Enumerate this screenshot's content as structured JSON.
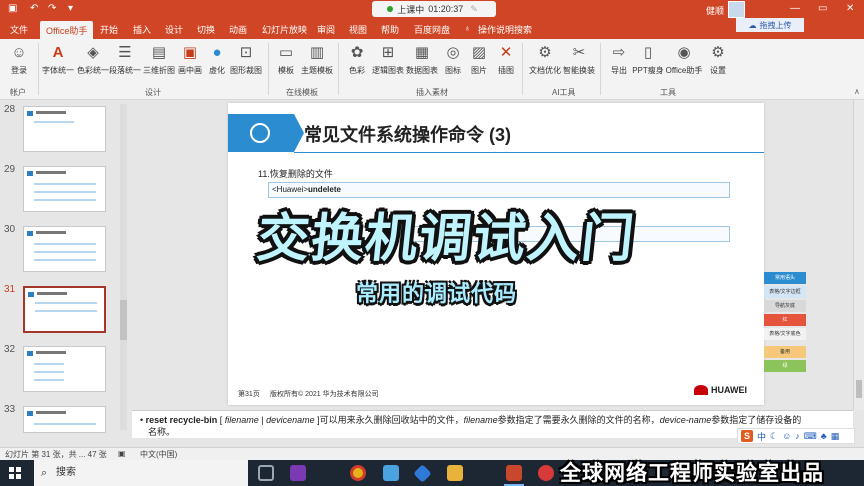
{
  "titlebar": {
    "save_icon": "save-icon",
    "undo_icon": "undo-icon",
    "redo_icon": "redo-icon",
    "recording_label": "上课中",
    "recording_time": "01:20:37",
    "user_name": "健顺",
    "minimize": "—",
    "maximize": "▭",
    "close": "✕"
  },
  "tabs": [
    "文件",
    "Office助手",
    "开始",
    "插入",
    "设计",
    "切换",
    "动画",
    "幻灯片放映",
    "审阅",
    "视图",
    "帮助",
    "百度网盘"
  ],
  "active_tab": "Office助手",
  "tell_me": "操作说明搜索",
  "upload_label": "拖拽上传",
  "ribbon": {
    "buttons": [
      {
        "label": "登录",
        "icon": "login-icon"
      },
      {
        "label": "字体统一",
        "icon": "font-icon"
      },
      {
        "label": "色彩统一",
        "icon": "paint-bucket-icon"
      },
      {
        "label": "段落统一",
        "icon": "paragraph-icon"
      },
      {
        "label": "三维折图",
        "icon": "fold-icon"
      },
      {
        "label": "画中画",
        "icon": "picture-in-picture-icon"
      },
      {
        "label": "虚化",
        "icon": "blur-icon"
      },
      {
        "label": "图形裁图",
        "icon": "crop-icon"
      },
      {
        "label": "模板",
        "icon": "template-icon"
      },
      {
        "label": "主题模板",
        "icon": "theme-icon"
      },
      {
        "label": "色彩",
        "icon": "palette-icon"
      },
      {
        "label": "逻辑图表",
        "icon": "logic-chart-icon"
      },
      {
        "label": "数据图表",
        "icon": "data-chart-icon"
      },
      {
        "label": "图标",
        "icon": "icon-library-icon"
      },
      {
        "label": "图片",
        "icon": "image-icon"
      },
      {
        "label": "插图",
        "icon": "illustration-icon"
      },
      {
        "label": "文档优化",
        "icon": "optimize-icon"
      },
      {
        "label": "智能换装",
        "icon": "smart-dress-icon"
      },
      {
        "label": "导出",
        "icon": "export-icon"
      },
      {
        "label": "PPT瘦身",
        "icon": "slim-icon"
      },
      {
        "label": "Office助手",
        "icon": "assistant-icon"
      },
      {
        "label": "设置",
        "icon": "settings-icon"
      }
    ],
    "groups": [
      "帐户",
      "设计",
      "在线模板",
      "插入素材",
      "AI工具",
      "工具"
    ]
  },
  "thumbnails": {
    "numbers": [
      "28",
      "29",
      "30",
      "31",
      "32",
      "33"
    ],
    "selected": "31"
  },
  "slide": {
    "title": "常见文件系统操作命令 (3)",
    "item": "11.恢复删除的文件",
    "cmd_prefix": "<Huawei>",
    "cmd_bold": "undelete",
    "footer_page": "第31页",
    "footer_copy": "版权所有© 2021 华为技术有限公司",
    "logo": "HUAWEI"
  },
  "overlay": {
    "title": "交换机调试入门",
    "subtitle": "常用的调试代码"
  },
  "palette": [
    {
      "label": "常用语头",
      "color": "#2b8dd0"
    },
    {
      "label": "表格/文字边框",
      "color": "#d4e5f5"
    },
    {
      "label": "导航灰底",
      "color": "#d9d9d9"
    },
    {
      "label": "红",
      "color": "#e5543c"
    },
    {
      "label": "表格/文字底色",
      "color": "#f2f2f2"
    },
    {
      "label": "备用",
      "color": "#f7c87a"
    },
    {
      "label": "绿",
      "color": "#8cc35a"
    }
  ],
  "notes": {
    "cmd": "reset recycle-bin",
    "p1": " [ ",
    "arg1": "filename",
    "p2": " | ",
    "arg2": "devicename",
    "p3": " ]可以用来永久删除回收站中的文件，",
    "arg3": "filename",
    "p4": "参数指定了需要永久删除的文件的名称，",
    "arg4": "device-name",
    "p5": "参数指定了储存设备的",
    "line2": "名称。"
  },
  "statusbar": {
    "slide_info": "幻灯片 第 31 张，共 ... 47 张",
    "language": "中文(中国)"
  },
  "ime": {
    "logo": "S",
    "mode": "中",
    "icons": [
      "moon-icon",
      "smile-icon",
      "mic-icon",
      "keyboard-icon",
      "shirt-icon",
      "grid-icon"
    ]
  },
  "taskbar": {
    "search_placeholder": "搜索",
    "apps": [
      {
        "name": "task-view-icon",
        "color": "#3a4654"
      },
      {
        "name": "onenote-icon",
        "color": "#7b3ab2"
      },
      {
        "name": "chrome-icon",
        "color": "#e3b21b"
      },
      {
        "name": "paint-icon",
        "color": "#4aa3df"
      },
      {
        "name": "app-diamond-icon",
        "color": "#2f7ad8"
      },
      {
        "name": "file-explorer-icon",
        "color": "#e9b23b"
      },
      {
        "name": "powerpoint-icon",
        "color": "#c9472b"
      },
      {
        "name": "screen-recorder-icon",
        "color": "#d83a3a"
      }
    ]
  },
  "bottom_caption": "全球网络工程师实验室出品"
}
